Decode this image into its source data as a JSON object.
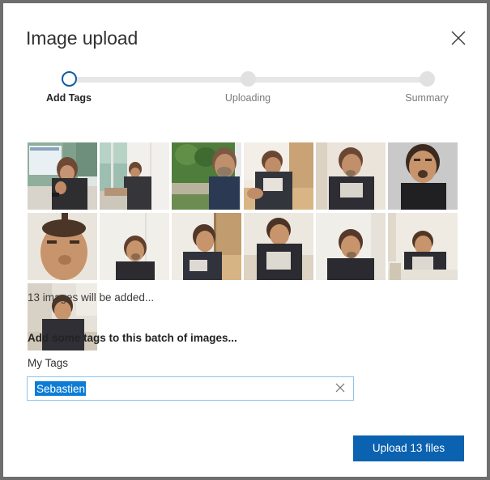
{
  "dialog": {
    "title": "Image upload",
    "close_icon": "close-icon"
  },
  "stepper": {
    "steps": [
      {
        "label": "Add Tags",
        "state": "active"
      },
      {
        "label": "Uploading",
        "state": "inactive"
      },
      {
        "label": "Summary",
        "state": "inactive"
      }
    ],
    "active_color": "#0f5ca3",
    "track_color": "#e6e6e6",
    "dot_color": "#e1e1e1"
  },
  "thumbnails": {
    "count": 13,
    "caption": "13 images will be added...",
    "items": [
      {
        "alt": "man at desk in front of monitors"
      },
      {
        "alt": "man working at desk by window"
      },
      {
        "alt": "selfie outdoors with green trees"
      },
      {
        "alt": "man at wooden table indoors"
      },
      {
        "alt": "man in black t-shirt looking left"
      },
      {
        "alt": "portrait of bearded man on grey wall"
      },
      {
        "alt": "close-up selfie with hair up"
      },
      {
        "alt": "man facing camera in white room"
      },
      {
        "alt": "man smiling next to wooden door"
      },
      {
        "alt": "man seated at table in profile"
      },
      {
        "alt": "man looking up in white room"
      },
      {
        "alt": "man leaning over desk"
      },
      {
        "alt": "man in grey room seated"
      }
    ]
  },
  "tags": {
    "heading": "Add some tags to this batch of images...",
    "field_label": "My Tags",
    "input_value": "Sebastien",
    "input_placeholder": "",
    "clear_icon": "clear-x-icon",
    "selection_color": "#0c7cd5",
    "border_color": "#8ec3ea"
  },
  "footer": {
    "upload_label": "Upload 13 files",
    "accent_color": "#0a62b0"
  }
}
